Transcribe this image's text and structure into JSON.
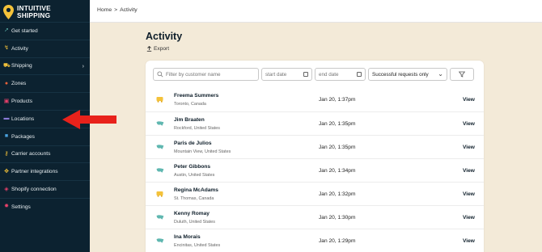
{
  "brand": {
    "line1": "INTUITIVE",
    "line2": "SHIPPING"
  },
  "colors": {
    "sidebar_bg": "#0c2230",
    "page_bg": "#f3ead8",
    "accent_yellow": "#f4c23a",
    "accent_teal": "#5fb7b0",
    "arrow_red": "#e8221b"
  },
  "sidebar": {
    "items": [
      {
        "label": "Get started",
        "icon": "rocket-icon",
        "color": "#5fb7b0"
      },
      {
        "label": "Activity",
        "icon": "activity-icon",
        "color": "#f4c23a"
      },
      {
        "label": "Shipping",
        "icon": "shipping-icon",
        "color": "#f4c23a",
        "chevron": "›"
      },
      {
        "label": "Zones",
        "icon": "zones-icon",
        "color": "#e8623a"
      },
      {
        "label": "Products",
        "icon": "products-icon",
        "color": "#e8406a"
      },
      {
        "label": "Locations",
        "icon": "locations-icon",
        "color": "#8a7ad8"
      },
      {
        "label": "Packages",
        "icon": "packages-icon",
        "color": "#4aa3df"
      },
      {
        "label": "Carrier accounts",
        "icon": "key-icon",
        "color": "#f4c23a"
      },
      {
        "label": "Partner integrations",
        "icon": "integrations-icon",
        "color": "#f4c23a"
      },
      {
        "label": "Shopify connection",
        "icon": "shopify-icon",
        "color": "#e8406a"
      },
      {
        "label": "Settings",
        "icon": "gear-icon",
        "color": "#e8406a"
      }
    ]
  },
  "breadcrumb": {
    "home": "Home",
    "sep": ">",
    "current": "Activity"
  },
  "page": {
    "title": "Activity",
    "export": "Export"
  },
  "filters": {
    "search_placeholder": "Filter by customer name",
    "start_placeholder": "start date",
    "end_placeholder": "end date",
    "select_value": "Successful requests only"
  },
  "rows": [
    {
      "name": "Freema Summers",
      "location": "Toronto, Canada",
      "date": "Jan 20, 1:37pm",
      "action": "View",
      "flag": "canada"
    },
    {
      "name": "Jim Braaten",
      "location": "Rockford, United States",
      "date": "Jan 20, 1:35pm",
      "action": "View",
      "flag": "us"
    },
    {
      "name": "Paris de Julios",
      "location": "Mountain View, United States",
      "date": "Jan 20, 1:35pm",
      "action": "View",
      "flag": "us"
    },
    {
      "name": "Peter Gibbons",
      "location": "Austin, United States",
      "date": "Jan 20, 1:34pm",
      "action": "View",
      "flag": "us"
    },
    {
      "name": "Regina McAdams",
      "location": "St. Thomas, Canada",
      "date": "Jan 20, 1:32pm",
      "action": "View",
      "flag": "canada"
    },
    {
      "name": "Kenny Romay",
      "location": "Duluth, United States",
      "date": "Jan 20, 1:30pm",
      "action": "View",
      "flag": "us"
    },
    {
      "name": "Ina Morais",
      "location": "Encinitas, United States",
      "date": "Jan 20, 1:29pm",
      "action": "View",
      "flag": "us"
    }
  ]
}
